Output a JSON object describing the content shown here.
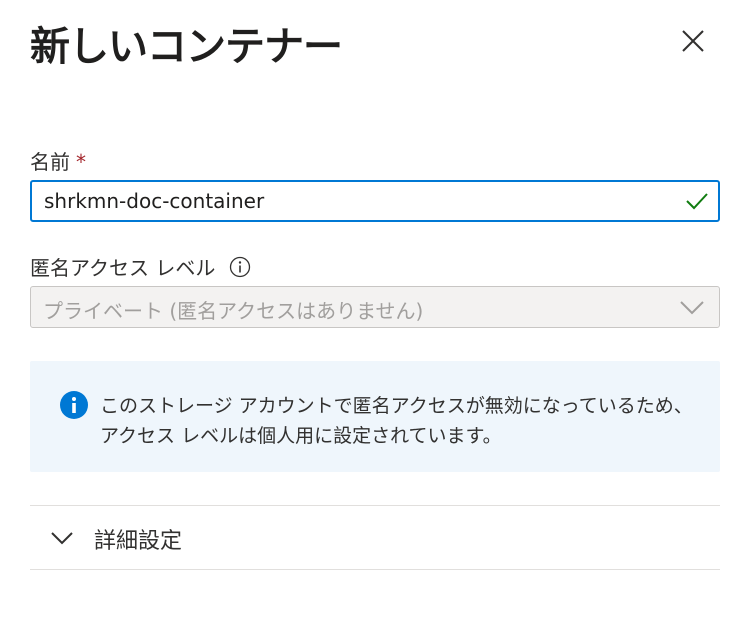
{
  "dialog": {
    "title": "新しいコンテナー",
    "close_icon": "close-icon"
  },
  "name_field": {
    "label": "名前",
    "required_marker": "*",
    "value": "shrkmn-doc-container",
    "valid_icon": "checkmark-icon"
  },
  "anonymous_access": {
    "label": "匿名アクセス レベル",
    "info_icon": "info-icon",
    "selected_value": "プライベート (匿名アクセスはありません)",
    "dropdown_icon": "chevron-down-icon"
  },
  "info_message": {
    "icon": "info-icon",
    "text": "このストレージ アカウントで匿名アクセスが無効になっているため、アクセス レベルは個人用に設定されています。"
  },
  "advanced_settings": {
    "label": "詳細設定",
    "icon": "chevron-down-icon"
  },
  "colors": {
    "accent": "#0078d4",
    "valid": "#107c10",
    "required": "#a4262c",
    "info_background": "#eff6fc"
  }
}
